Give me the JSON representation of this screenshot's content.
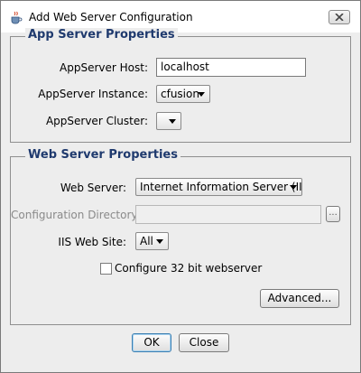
{
  "window": {
    "title": "Add Web Server Configuration"
  },
  "app_server": {
    "legend": "App Server Properties",
    "host_label": "AppServer Host:",
    "host_value": "localhost",
    "instance_label": "AppServer Instance:",
    "instance_value": "cfusion",
    "cluster_label": "AppServer Cluster:",
    "cluster_value": ""
  },
  "web_server": {
    "legend": "Web Server Properties",
    "server_label": "Web Server:",
    "server_value": "Internet Information Server (IIS)",
    "config_dir_label": "Configuration Directory:",
    "config_dir_value": "",
    "browse_label": "...",
    "site_label": "IIS Web Site:",
    "site_value": "All",
    "checkbox_label": "Configure 32 bit webserver",
    "checkbox_checked": false,
    "advanced_label": "Advanced..."
  },
  "footer": {
    "ok_label": "OK",
    "close_label": "Close"
  }
}
